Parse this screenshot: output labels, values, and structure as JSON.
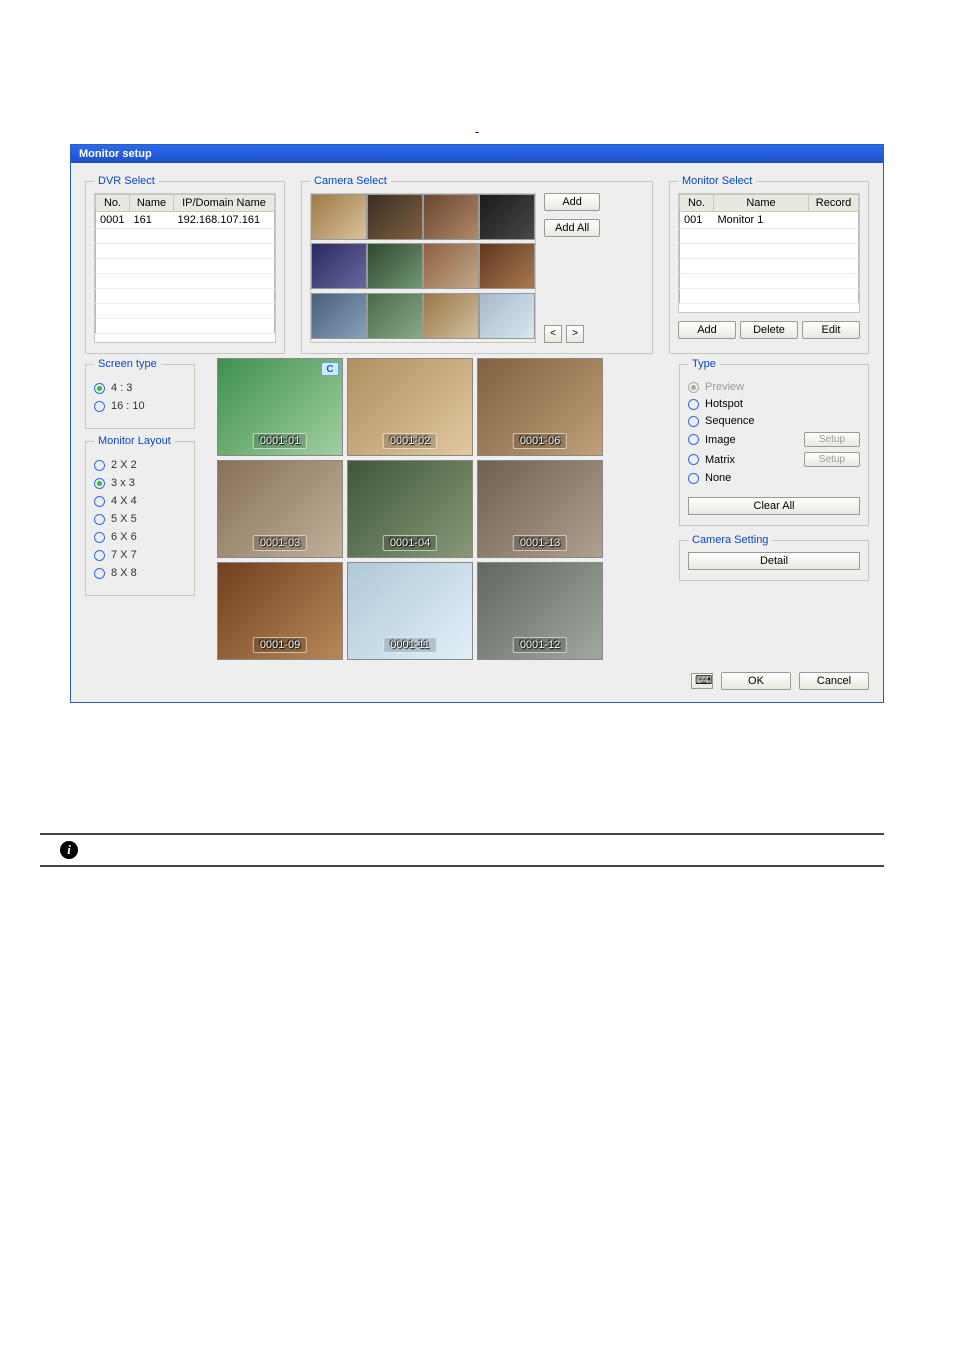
{
  "dialog": {
    "title": "Monitor setup"
  },
  "dvr_select": {
    "legend": "DVR Select",
    "headers": [
      "No.",
      "Name",
      "IP/Domain Name"
    ],
    "rows": [
      {
        "no": "0001",
        "name": "161",
        "ip": "192.168.107.161"
      }
    ]
  },
  "camera_select": {
    "legend": "Camera Select",
    "add": "Add",
    "add_all": "Add All",
    "prev": "<",
    "next": ">"
  },
  "monitor_select": {
    "legend": "Monitor Select",
    "headers": [
      "No.",
      "Name",
      "Record"
    ],
    "rows": [
      {
        "no": "001",
        "name": "Monitor 1",
        "record": ""
      }
    ],
    "add": "Add",
    "delete": "Delete",
    "edit": "Edit"
  },
  "screen_type": {
    "legend": "Screen type",
    "options": [
      {
        "label": "4 : 3",
        "checked": true
      },
      {
        "label": "16 : 10",
        "checked": false
      }
    ]
  },
  "monitor_layout": {
    "legend": "Monitor Layout",
    "options": [
      {
        "label": "2 X 2",
        "checked": false
      },
      {
        "label": "3 x 3",
        "checked": true
      },
      {
        "label": "4 X 4",
        "checked": false
      },
      {
        "label": "5 X 5",
        "checked": false
      },
      {
        "label": "6 X 6",
        "checked": false
      },
      {
        "label": "7 X 7",
        "checked": false
      },
      {
        "label": "8 X 8",
        "checked": false
      }
    ]
  },
  "preview_cells": [
    {
      "label": "0001-01",
      "has_icon": true
    },
    {
      "label": "0001-02",
      "has_icon": false
    },
    {
      "label": "0001-06",
      "has_icon": false
    },
    {
      "label": "0001-03",
      "has_icon": false
    },
    {
      "label": "0001-04",
      "has_icon": false
    },
    {
      "label": "0001-13",
      "has_icon": false
    },
    {
      "label": "0001-09",
      "has_icon": false
    },
    {
      "label": "0001-11",
      "has_icon": false
    },
    {
      "label": "0001-12",
      "has_icon": false
    }
  ],
  "type": {
    "legend": "Type",
    "options": [
      {
        "label": "Preview",
        "checked": true,
        "disabled": true
      },
      {
        "label": "Hotspot",
        "checked": false
      },
      {
        "label": "Sequence",
        "checked": false
      },
      {
        "label": "Image",
        "checked": false,
        "setup": true
      },
      {
        "label": "Matrix",
        "checked": false,
        "setup": true
      },
      {
        "label": "None",
        "checked": false
      }
    ],
    "setup": "Setup",
    "clear_all": "Clear All"
  },
  "camera_setting": {
    "legend": "Camera Setting",
    "detail": "Detail"
  },
  "footer": {
    "ok": "OK",
    "cancel": "Cancel"
  },
  "info_icon": "i"
}
